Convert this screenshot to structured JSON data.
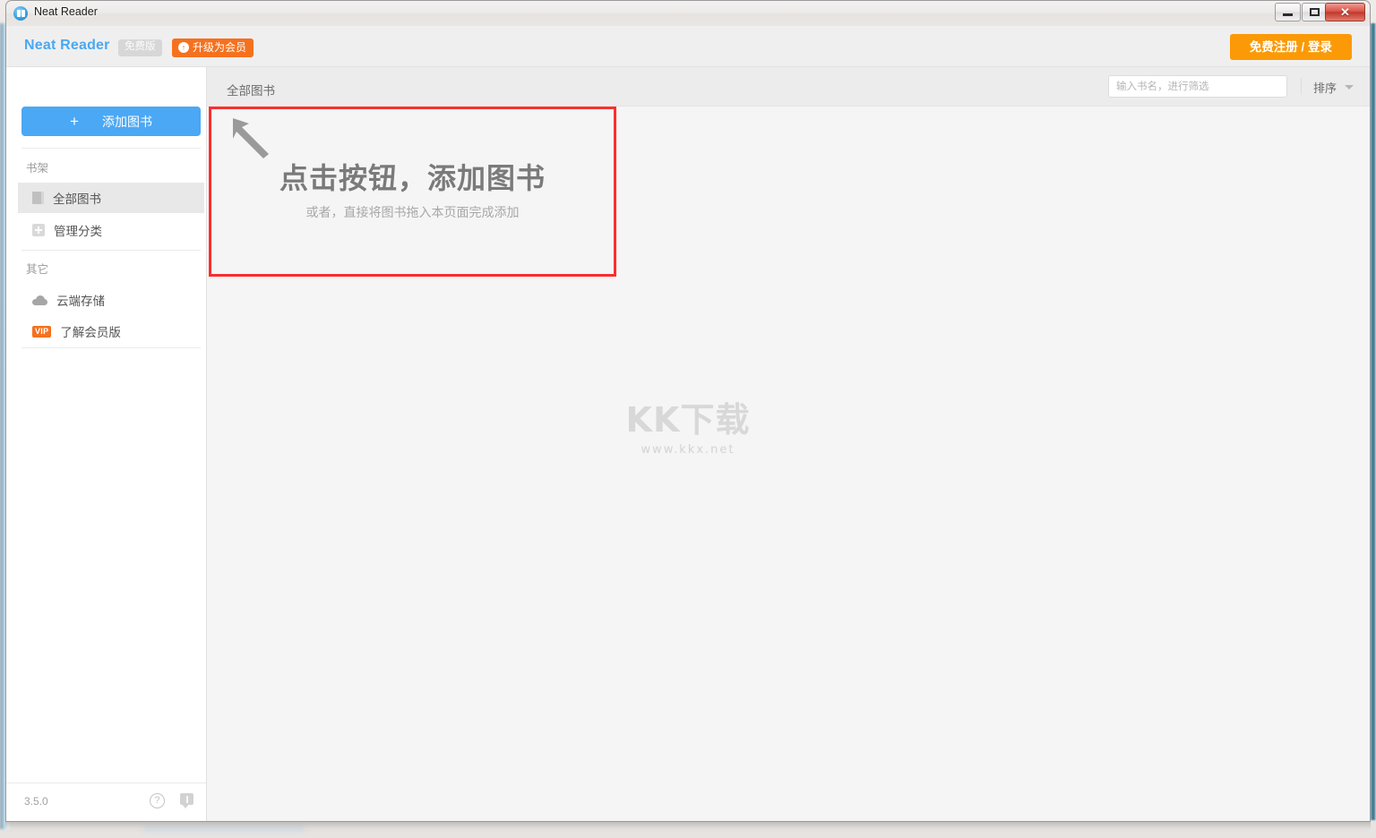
{
  "window": {
    "title": "Neat Reader",
    "app_icon": "book-circle-icon",
    "controls": {
      "minimize": "minimize-icon",
      "maximize": "restore-icon",
      "close": "✕"
    }
  },
  "header": {
    "brand": "Neat Reader",
    "badge_free": "免费版",
    "badge_upgrade": "升级为会员",
    "badge_upgrade_icon": "↑",
    "register_login": "免费注册 / 登录",
    "accent_blue": "#4aa8f0",
    "accent_orange": "#f5711e",
    "register_orange": "#fb9a06"
  },
  "sidebar": {
    "add_book": "添加图书",
    "add_book_plus": "+",
    "sections": [
      {
        "label": "书架"
      },
      {
        "label": "其它"
      }
    ],
    "items": [
      {
        "label": "全部图书",
        "icon": "book-icon",
        "active": true
      },
      {
        "label": "管理分类",
        "icon": "plus-square-icon",
        "active": false
      },
      {
        "label": "云端存储",
        "icon": "cloud-icon",
        "active": false
      },
      {
        "label": "了解会员版",
        "icon": "vip-badge-icon",
        "badge": "VIP",
        "active": false
      }
    ],
    "footer": {
      "version": "3.5.0",
      "help_icon": "?",
      "feedback_icon": "feedback-icon"
    }
  },
  "content": {
    "shelf_title": "全部图书",
    "search": {
      "value": "",
      "placeholder": "输入书名，进行筛选"
    },
    "sort_label": "排序",
    "dropzone": {
      "title": "点击按钮，添加图书",
      "subtitle": "或者，直接将图书拖入本页面完成添加",
      "arrow_icon": "arrow-up-left-icon",
      "highlight_color": "#fb2e2e"
    }
  },
  "watermark": {
    "main": "KK下载",
    "sub": "www.kkx.net"
  }
}
